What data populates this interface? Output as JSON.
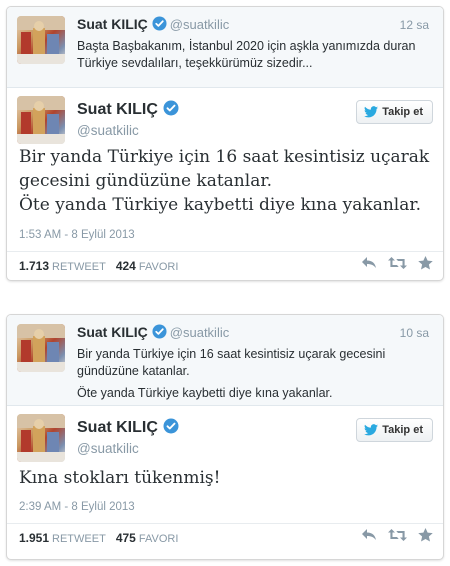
{
  "cards": [
    {
      "context": {
        "name": "Suat KILIÇ",
        "handle": "@suatkilic",
        "time": "12 sa",
        "text_lines": [
          "Başta Başbakanım, İstanbul 2020 için aşkla yanımızda duran Türkiye sevdalıları, teşekkürümüz sizedir..."
        ]
      },
      "main": {
        "name": "Suat KILIÇ",
        "handle": "@suatkilic",
        "follow_label": "Takip et",
        "text_lines": [
          "Bir yanda Türkiye için 16 saat kesintisiz uçarak gecesini gündüzüne katanlar.",
          "Öte yanda Türkiye kaybetti diye kına yakanlar."
        ],
        "timestamp": "1:53 AM - 8 Eylül 2013",
        "retweets": "1.713",
        "retweet_label": "RETWEET",
        "favorites": "424",
        "favorite_label": "FAVORI"
      }
    },
    {
      "context": {
        "name": "Suat KILIÇ",
        "handle": "@suatkilic",
        "time": "10 sa",
        "text_lines": [
          "Bir yanda Türkiye için 16 saat kesintisiz uçarak gecesini gündüzüne katanlar.",
          "Öte yanda Türkiye kaybetti diye kına yakanlar."
        ]
      },
      "main": {
        "name": "Suat KILIÇ",
        "handle": "@suatkilic",
        "follow_label": "Takip et",
        "text_lines": [
          "Kına stokları tükenmiş!"
        ],
        "timestamp": "2:39 AM - 8 Eylül 2013",
        "retweets": "1.951",
        "retweet_label": "RETWEET",
        "favorites": "475",
        "favorite_label": "FAVORI"
      }
    }
  ],
  "icons": {
    "verified": "verified-badge-icon",
    "follow": "twitter-bird-icon",
    "reply": "reply-icon",
    "retweet": "retweet-icon",
    "favorite": "star-icon"
  },
  "colors": {
    "verified": "#3b94d9",
    "follow_bird": "#2aa9e0",
    "muted_text": "#8899a6",
    "action_icons": "#8899a6"
  }
}
